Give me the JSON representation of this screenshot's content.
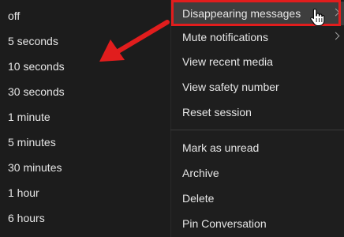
{
  "timer_options": [
    "off",
    "5 seconds",
    "10 seconds",
    "30 seconds",
    "1 minute",
    "5 minutes",
    "30 minutes",
    "1 hour",
    "6 hours"
  ],
  "context_menu": {
    "items": [
      {
        "label": "Disappearing messages",
        "has_submenu": true,
        "highlighted": true
      },
      {
        "label": "Mute notifications",
        "has_submenu": true
      },
      {
        "label": "View recent media"
      },
      {
        "label": "View safety number"
      },
      {
        "label": "Reset session"
      },
      {
        "label": "Mark as unread"
      },
      {
        "label": "Archive"
      },
      {
        "label": "Delete"
      },
      {
        "label": "Pin Conversation"
      }
    ]
  },
  "colors": {
    "background": "#1c1c1c",
    "highlight": "#3e3e3e",
    "annotation_red": "#e11d1d",
    "text": "#e6e6e6"
  },
  "icons": {
    "submenu_indicator": "chevron-right-icon",
    "cursor": "hand-pointer-icon",
    "annotation": "red-arrow-icon"
  }
}
